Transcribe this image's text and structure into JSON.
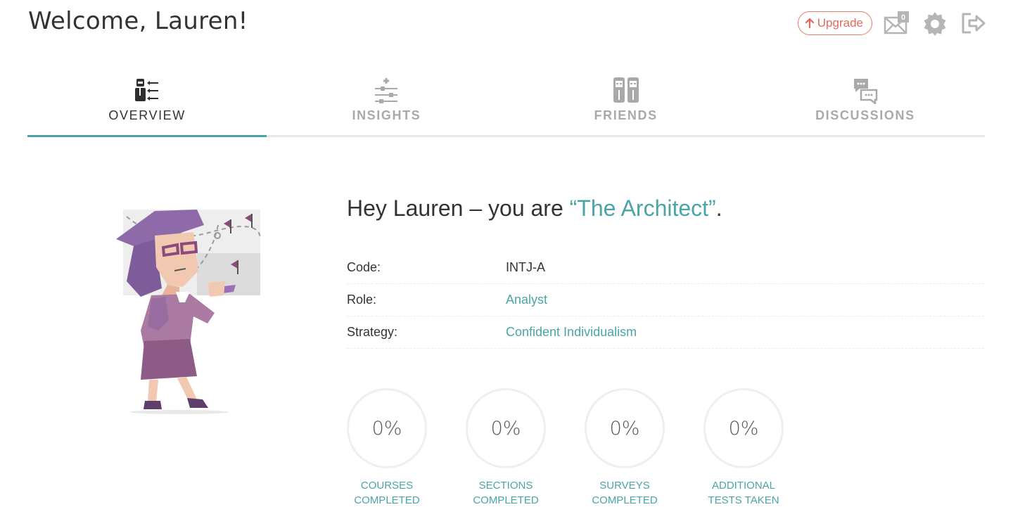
{
  "header": {
    "welcome": "Welcome, Lauren!",
    "upgrade_label": "Upgrade",
    "mail_count": "0"
  },
  "icons": {
    "upgrade": "arrow-up-icon",
    "mail": "mail-icon",
    "settings": "gear-icon",
    "logout": "logout-icon"
  },
  "tabs": [
    {
      "label": "OVERVIEW",
      "active": true,
      "icon": "overview-icon"
    },
    {
      "label": "INSIGHTS",
      "active": false,
      "icon": "sliders-icon"
    },
    {
      "label": "FRIENDS",
      "active": false,
      "icon": "friends-icon"
    },
    {
      "label": "DISCUSSIONS",
      "active": false,
      "icon": "discussions-icon"
    }
  ],
  "profile": {
    "headline_prefix": "Hey Lauren – you are ",
    "type_name": "“The Architect”",
    "headline_suffix": ".",
    "traits": [
      {
        "key": "Code:",
        "value": "INTJ-A",
        "link": false
      },
      {
        "key": "Role:",
        "value": "Analyst",
        "link": true
      },
      {
        "key": "Strategy:",
        "value": "Confident Individualism",
        "link": true
      }
    ]
  },
  "stats": [
    {
      "value": "0%",
      "label_line1": "COURSES",
      "label_line2": "COMPLETED"
    },
    {
      "value": "0%",
      "label_line1": "SECTIONS",
      "label_line2": "COMPLETED"
    },
    {
      "value": "0%",
      "label_line1": "SURVEYS",
      "label_line2": "COMPLETED"
    },
    {
      "value": "0%",
      "label_line1": "ADDITIONAL",
      "label_line2": "TESTS TAKEN"
    }
  ],
  "colors": {
    "accent": "#4aa5a7",
    "upgrade": "#df6b5b",
    "icon_gray": "#b5b5b5",
    "text": "#333333"
  }
}
